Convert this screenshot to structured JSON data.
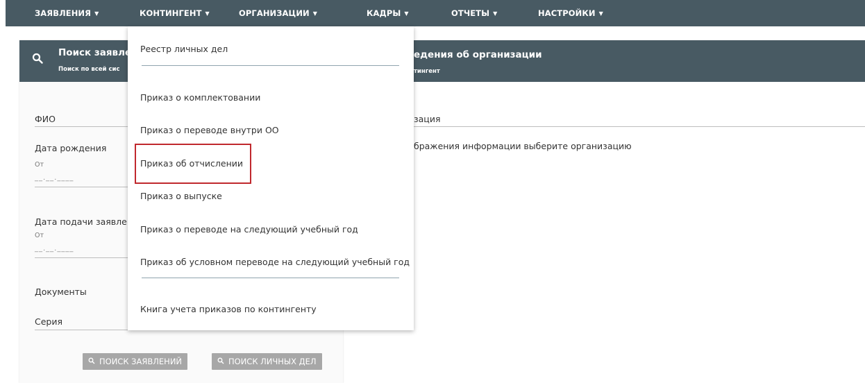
{
  "nav": {
    "items": [
      {
        "label": "ЗАЯВЛЕНИЯ"
      },
      {
        "label": "КОНТИНГЕНТ"
      },
      {
        "label": "ОРГАНИЗАЦИИ"
      },
      {
        "label": "КАДРЫ"
      },
      {
        "label": "ОТЧЕТЫ"
      },
      {
        "label": "НАСТРОЙКИ"
      }
    ]
  },
  "left": {
    "title": "Поиск заявле",
    "subtitle": "Поиск по всей сис",
    "fio_label": "ФИО",
    "birth_label": "Дата рождения",
    "birth_from": "От",
    "birth_date_placeholder": "__.__.____",
    "submit_label": "Дата подачи заявлен",
    "submit_from": "От",
    "submit_date_placeholder": "__.__.____",
    "documents_label": "Документы",
    "series_label": "Серия",
    "btn_search_applications": "ПОИСК ЗАЯВЛЕНИЙ",
    "btn_search_records": "ПОИСК ЛИЧНЫХ ДЕЛ"
  },
  "right": {
    "title": "едения об организации",
    "subtitle": "тингент",
    "org_label": "зация",
    "hint": "бражения информации выберите организацию"
  },
  "dropdown": {
    "items": [
      {
        "label": "Реестр личных дел"
      },
      {
        "label": "Приказ о комплектовании"
      },
      {
        "label": "Приказ о переводе внутри ОО"
      },
      {
        "label": "Приказ об отчислении"
      },
      {
        "label": "Приказ о выпуске"
      },
      {
        "label": "Приказ о переводе на следующий учебный год"
      },
      {
        "label": "Приказ об условном переводе на следующий учебный год"
      },
      {
        "label": "Книга учета приказов по контингенту"
      }
    ]
  },
  "highlight_color": "#c0282d",
  "header_color": "#485a63"
}
